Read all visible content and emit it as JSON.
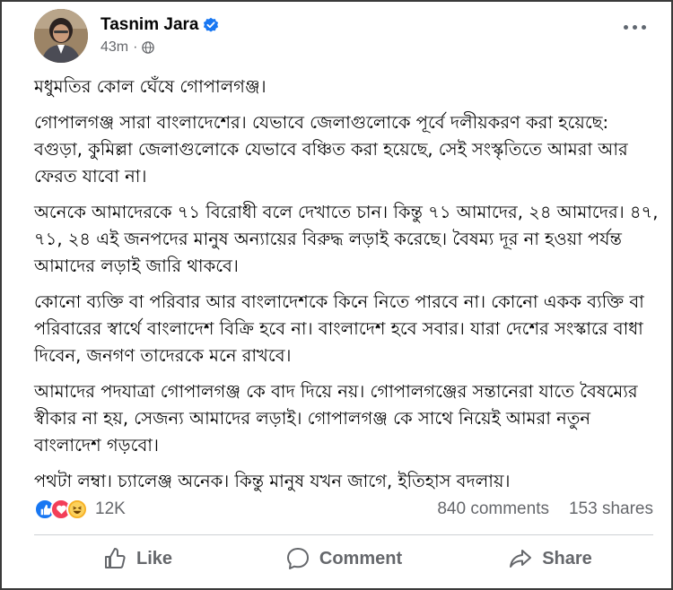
{
  "post": {
    "author": "Tasnim Jara",
    "time": "43m",
    "separator": "·",
    "paragraphs": [
      "মধুমতির কোল ঘেঁষে গোপালগঞ্জ।",
      "গোপালগঞ্জ সারা বাংলাদেশের। যেভাবে জেলাগুলোকে পূর্বে দলীয়করণ করা হয়েছে: বগুড়া, কুমিল্লা জেলাগুলোকে যেভাবে বঞ্চিত করা হয়েছে, সেই সংস্কৃতিতে আমরা আর ফেরত যাবো না।",
      "অনেকে আমাদেরকে ৭১ বিরোধী বলে দেখাতে চান। কিন্তু ৭১ আমাদের, ২৪ আমাদের। ৪৭, ৭১, ২৪ এই জনপদের মানুষ অন্যায়ের বিরুদ্ধ লড়াই করেছে। বৈষম্য দূর না হওয়া পর্যন্ত আমাদের লড়াই জারি থাকবে।",
      "কোনো ব্যক্তি বা পরিবার আর বাংলাদেশকে কিনে নিতে পারবে না। কোনো একক ব্যক্তি বা পরিবারের স্বার্থে বাংলাদেশ বিক্রি হবে না। বাংলাদেশ হবে সবার। যারা দেশের সংস্কারে বাধা দিবেন, জনগণ তাদেরকে মনে রাখবে।",
      "আমাদের পদযাত্রা গোপালগঞ্জ কে বাদ দিয়ে নয়। গোপালগঞ্জের সন্তানেরা যাতে বৈষম্যের স্বীকার না হয়, সেজন্য আমাদের লড়াই। গোপালগঞ্জ কে সাথে নিয়েই আমরা নতুন বাংলাদেশ গড়বো।",
      "পথটা লম্বা। চ্যালেঞ্জ অনেক। কিন্তু মানুষ যখন জাগে, ইতিহাস বদলায়।"
    ]
  },
  "stats": {
    "reactions": "12K",
    "comments": "840 comments",
    "shares": "153 shares"
  },
  "actions": {
    "like": "Like",
    "comment": "Comment",
    "share": "Share"
  },
  "colors": {
    "accent": "#1877f2",
    "muted": "#65676b",
    "love": "#f33e58",
    "haha": "#f7b125"
  },
  "icons": [
    "verified-badge-icon",
    "globe-icon",
    "more-options-icon",
    "like-reaction-icon",
    "love-reaction-icon",
    "haha-reaction-icon",
    "thumbs-up-icon",
    "comment-icon",
    "share-icon"
  ]
}
